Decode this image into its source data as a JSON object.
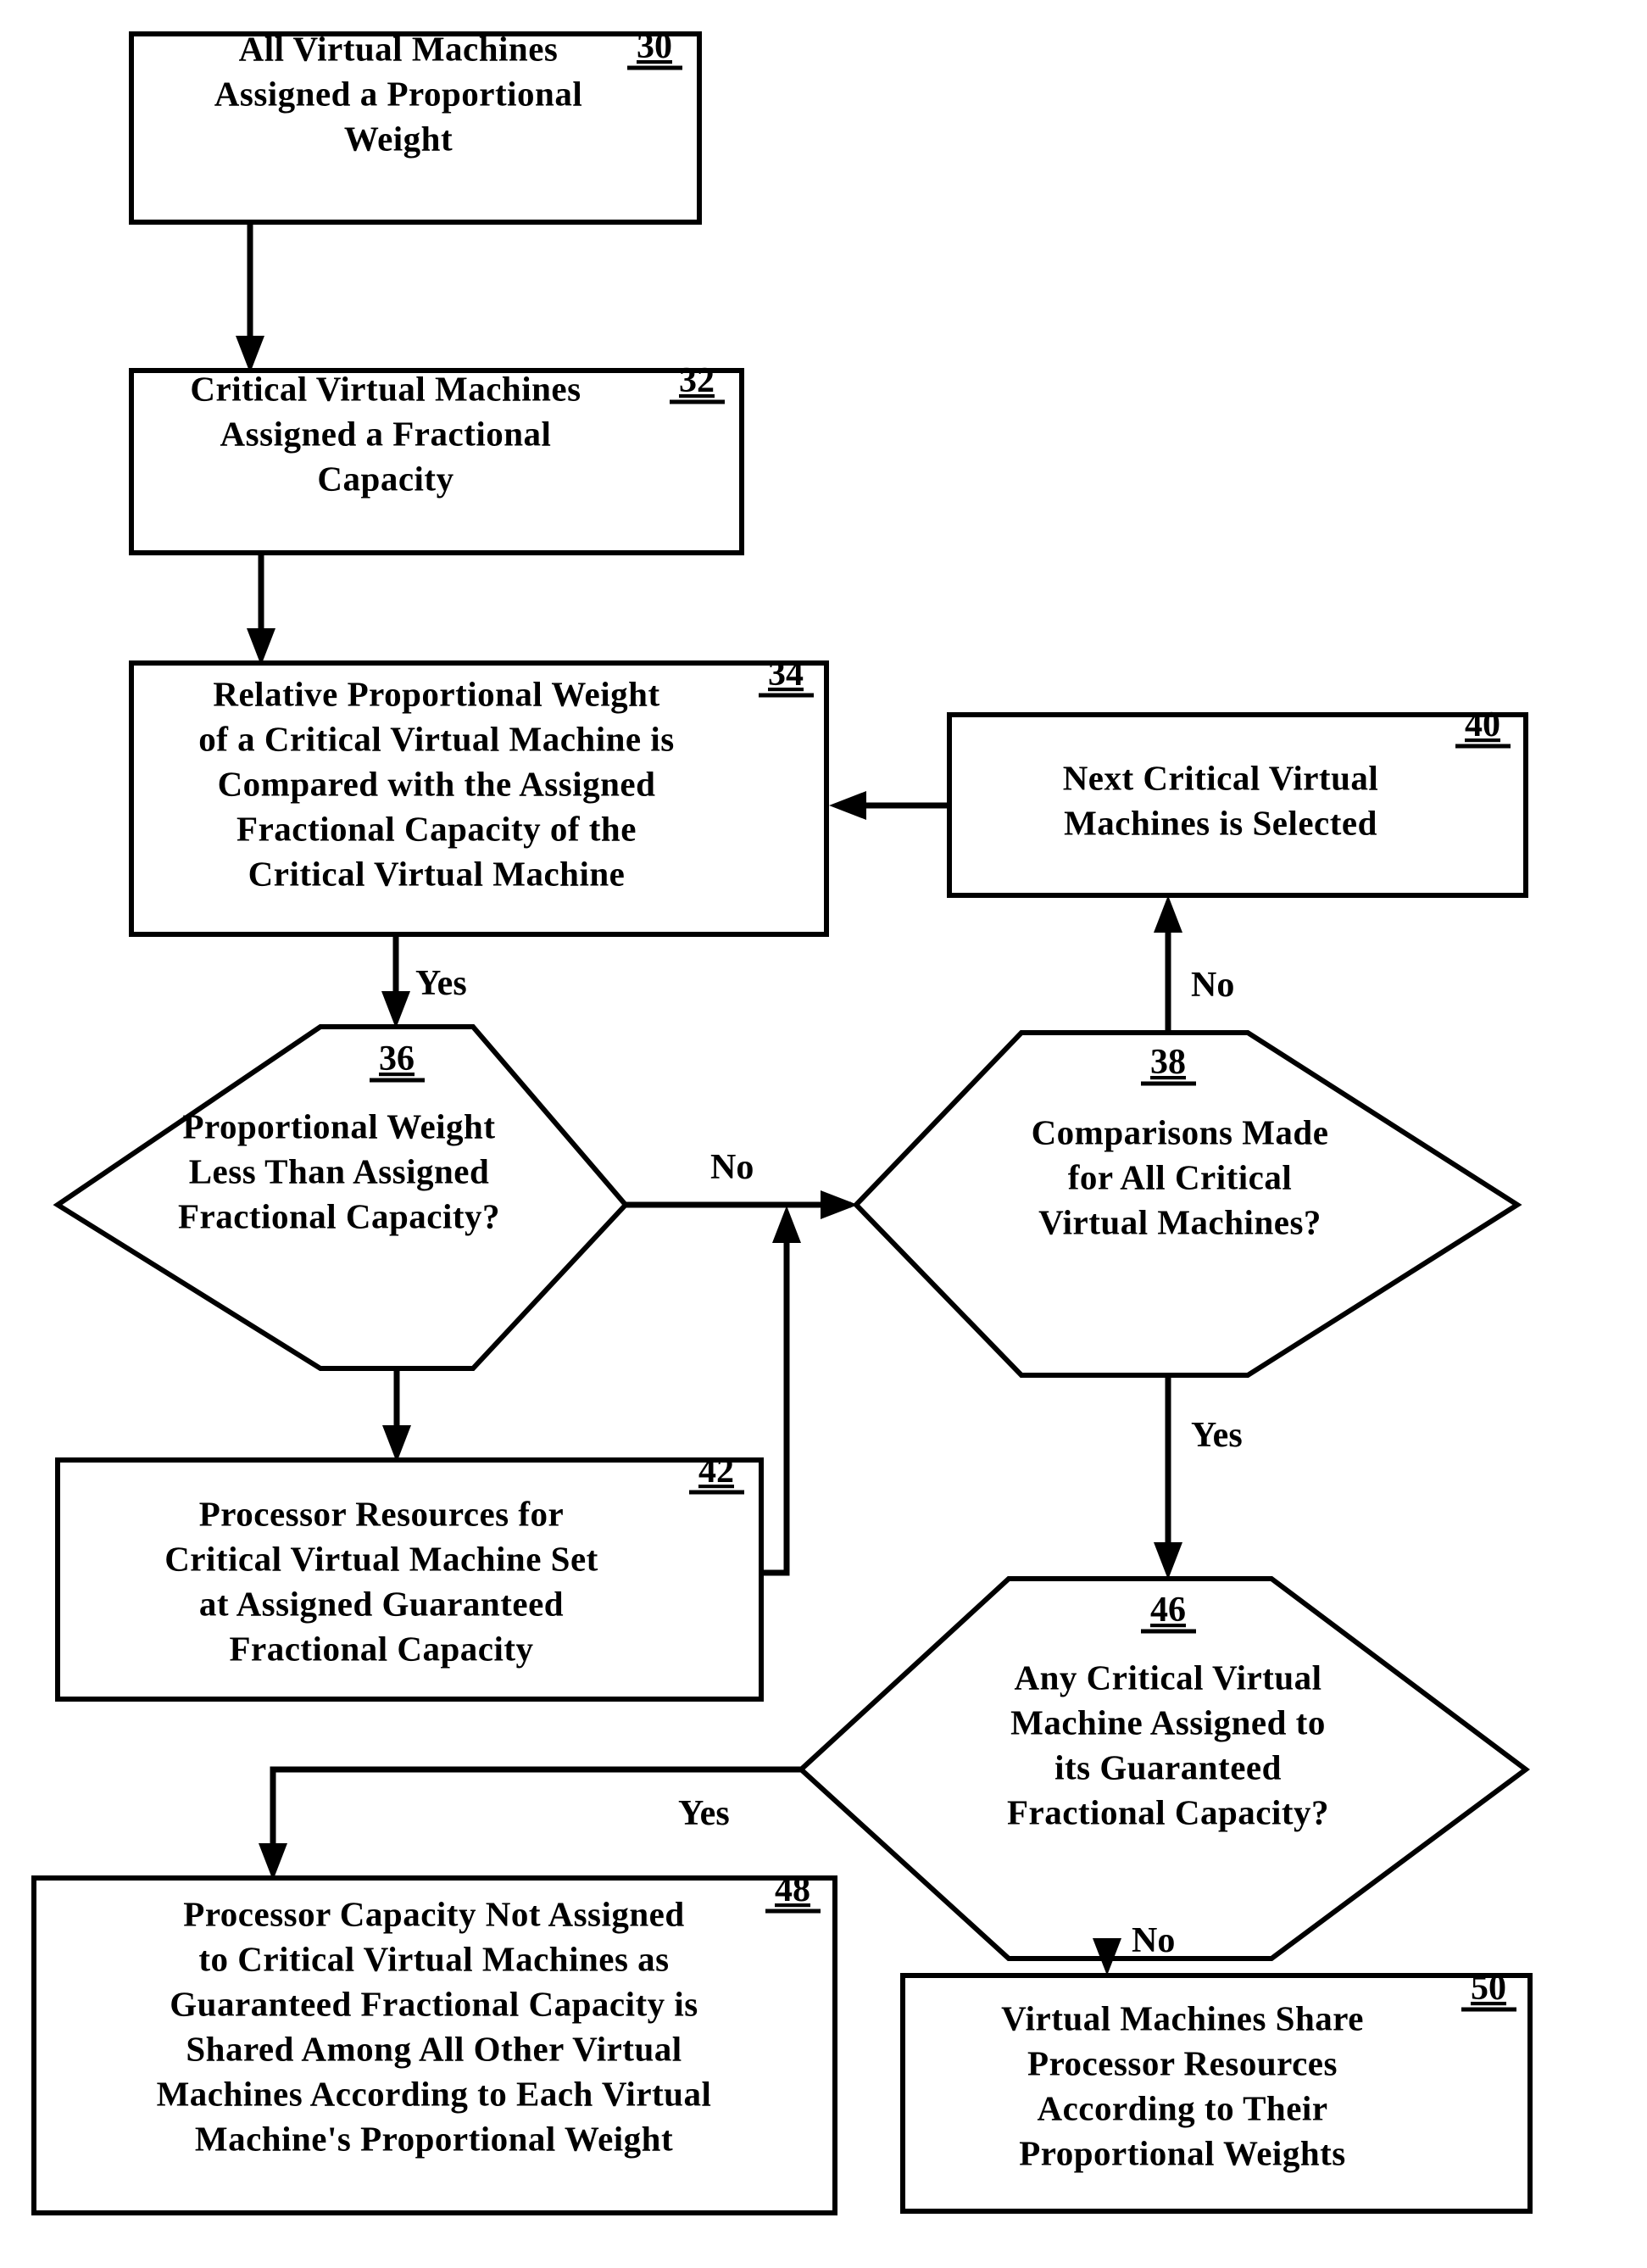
{
  "figure": {
    "type": "flowchart",
    "background_color": "#ffffff",
    "line_color": "#000000"
  },
  "nodes": [
    {
      "ref": "30",
      "shape": "process-box",
      "lines": [
        "All Virtual Machines",
        "Assigned a Proportional",
        "Weight"
      ]
    },
    {
      "ref": "32",
      "shape": "process-box",
      "lines": [
        "Critical Virtual Machines",
        "Assigned a Fractional",
        "Capacity"
      ]
    },
    {
      "ref": "34",
      "shape": "process-box",
      "lines": [
        "Relative Proportional Weight",
        "of a Critical Virtual Machine is",
        "Compared with the Assigned",
        "Fractional Capacity of the",
        "Critical Virtual Machine"
      ]
    },
    {
      "ref": "40",
      "shape": "process-box",
      "lines": [
        "Next Critical Virtual",
        "Machines is Selected"
      ]
    },
    {
      "ref": "36",
      "shape": "decision-hexagon",
      "lines": [
        "Proportional Weight",
        "Less Than Assigned",
        "Fractional Capacity?"
      ]
    },
    {
      "ref": "38",
      "shape": "decision-hexagon",
      "lines": [
        "Comparisons Made",
        "for All Critical",
        "Virtual Machines?"
      ]
    },
    {
      "ref": "42",
      "shape": "process-box",
      "lines": [
        "Processor Resources for",
        "Critical Virtual Machine Set",
        "at Assigned Guaranteed",
        "Fractional Capacity"
      ]
    },
    {
      "ref": "46",
      "shape": "decision-hexagon",
      "lines": [
        "Any Critical Virtual",
        "Machine Assigned to",
        "its Guaranteed",
        "Fractional Capacity?"
      ]
    },
    {
      "ref": "48",
      "shape": "process-box",
      "lines": [
        "Processor Capacity Not Assigned",
        "to Critical Virtual Machines as",
        "Guaranteed Fractional Capacity is",
        "Shared Among All Other Virtual",
        "Machines According to Each Virtual",
        "Machine's Proportional Weight"
      ]
    },
    {
      "ref": "50",
      "shape": "process-box",
      "lines": [
        "Virtual Machines Share",
        "Processor Resources",
        "According to Their",
        "Proportional Weights"
      ]
    }
  ],
  "edges": [
    {
      "from": "30",
      "to": "32",
      "label": ""
    },
    {
      "from": "32",
      "to": "34",
      "label": ""
    },
    {
      "from": "34",
      "to": "36",
      "label": "Yes"
    },
    {
      "from": "36",
      "to": "38",
      "label": "No"
    },
    {
      "from": "36",
      "to": "42",
      "label": ""
    },
    {
      "from": "42",
      "to": "38",
      "label": ""
    },
    {
      "from": "38",
      "to": "40",
      "label": "No"
    },
    {
      "from": "40",
      "to": "34",
      "label": ""
    },
    {
      "from": "38",
      "to": "46",
      "label": "Yes"
    },
    {
      "from": "46",
      "to": "48",
      "label": "Yes"
    },
    {
      "from": "46",
      "to": "50",
      "label": "No"
    }
  ],
  "edge_labels": {
    "yes_34_36": "Yes",
    "no_36_38": "No",
    "no_38_40": "No",
    "yes_38_46": "Yes",
    "yes_46_48": "Yes",
    "no_46_50": "No"
  }
}
